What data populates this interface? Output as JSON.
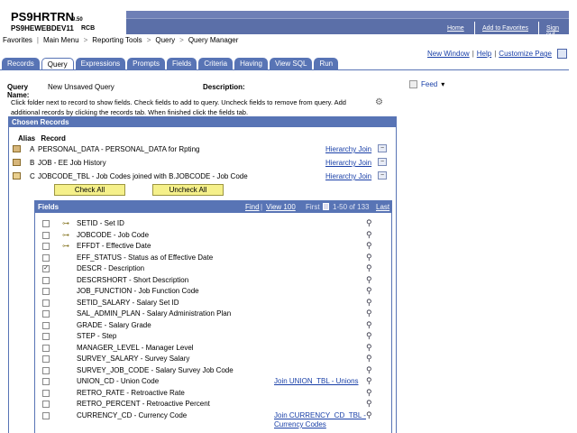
{
  "header": {
    "db_name": "PS9HRTRN",
    "db_version": "9.50",
    "server": "PS9HEWEBDEV11",
    "user": "RCB",
    "links": [
      "Home",
      "Add to Favorites",
      "Sign out"
    ]
  },
  "breadcrumb": [
    "Favorites",
    "Main Menu",
    "Reporting Tools",
    "Query",
    "Query Manager"
  ],
  "top_links": {
    "new_window": "New Window",
    "help": "Help",
    "customize": "Customize Page"
  },
  "tabs": [
    "Records",
    "Query",
    "Expressions",
    "Prompts",
    "Fields",
    "Criteria",
    "Having",
    "View SQL",
    "Run"
  ],
  "active_tab": "Query",
  "query": {
    "name_label": "Query Name:",
    "name_value": "New Unsaved Query",
    "desc_label": "Description:",
    "feed_label": "Feed"
  },
  "instructions": "Click folder next to record to show fields. Check fields to add to query. Uncheck fields to remove from query. Add additional records by clicking the records tab. When finished click the fields tab.",
  "chosen": {
    "title": "Chosen Records",
    "col_alias": "Alias",
    "col_record": "Record",
    "records": [
      {
        "alias": "A",
        "name": "PERSONAL_DATA - PERSONAL_DATA for Rpting",
        "join": "Hierarchy Join",
        "state": "closed"
      },
      {
        "alias": "B",
        "name": "JOB - EE Job History",
        "join": "Hierarchy Join",
        "state": "closed"
      },
      {
        "alias": "C",
        "name": "JOBCODE_TBL - Job Codes joined with B.JOBCODE - Job Code",
        "join": "Hierarchy Join",
        "state": "open"
      }
    ],
    "check_all": "Check All",
    "uncheck_all": "Uncheck All"
  },
  "fields_grid": {
    "title": "Fields",
    "find": "Find",
    "view": "View 100",
    "first": "First",
    "range": "1-50 of 133",
    "last": "Last",
    "rows": [
      {
        "name": "SETID - Set ID",
        "key": true,
        "checked": false,
        "join": ""
      },
      {
        "name": "JOBCODE - Job Code",
        "key": true,
        "checked": false,
        "join": ""
      },
      {
        "name": "EFFDT - Effective Date",
        "key": true,
        "checked": false,
        "join": ""
      },
      {
        "name": "EFF_STATUS - Status as of Effective Date",
        "key": false,
        "checked": false,
        "join": ""
      },
      {
        "name": "DESCR - Description",
        "key": false,
        "checked": true,
        "join": ""
      },
      {
        "name": "DESCRSHORT - Short Description",
        "key": false,
        "checked": false,
        "join": ""
      },
      {
        "name": "JOB_FUNCTION - Job Function Code",
        "key": false,
        "checked": false,
        "join": ""
      },
      {
        "name": "SETID_SALARY - Salary Set ID",
        "key": false,
        "checked": false,
        "join": ""
      },
      {
        "name": "SAL_ADMIN_PLAN - Salary Administration Plan",
        "key": false,
        "checked": false,
        "join": ""
      },
      {
        "name": "GRADE - Salary Grade",
        "key": false,
        "checked": false,
        "join": ""
      },
      {
        "name": "STEP - Step",
        "key": false,
        "checked": false,
        "join": ""
      },
      {
        "name": "MANAGER_LEVEL - Manager Level",
        "key": false,
        "checked": false,
        "join": ""
      },
      {
        "name": "SURVEY_SALARY - Survey Salary",
        "key": false,
        "checked": false,
        "join": ""
      },
      {
        "name": "SURVEY_JOB_CODE - Salary Survey Job Code",
        "key": false,
        "checked": false,
        "join": ""
      },
      {
        "name": "UNION_CD - Union Code",
        "key": false,
        "checked": false,
        "join": "Join UNION_TBL - Unions"
      },
      {
        "name": "RETRO_RATE - Retroactive Rate",
        "key": false,
        "checked": false,
        "join": ""
      },
      {
        "name": "RETRO_PERCENT - Retroactive Percent",
        "key": false,
        "checked": false,
        "join": ""
      },
      {
        "name": "CURRENCY_CD - Currency Code",
        "key": false,
        "checked": false,
        "join": "Join CURRENCY_CD_TBL -"
      }
    ],
    "partial_join_line": "Currency Codes"
  }
}
